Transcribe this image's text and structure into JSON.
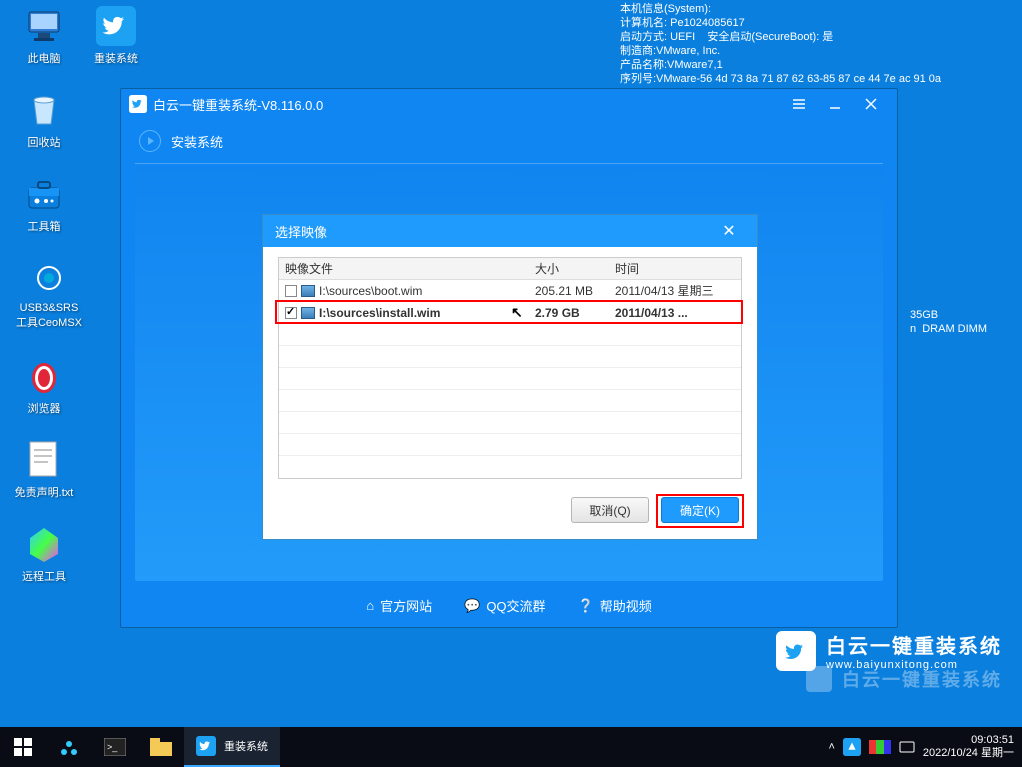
{
  "desktop_icons": {
    "this_pc": "此电脑",
    "reinstall": "重装系统",
    "recycle": "回收站",
    "toolbox": "工具箱",
    "usb3": "USB3&SRS\n工具CeoMSX",
    "browser": "浏览器",
    "disclaimer": "免责声明.txt",
    "remote": "远程工具"
  },
  "system_info": "本机信息(System):\n计算机名: Pe1024085617\n启动方式: UEFI    安全启动(SecureBoot): 是\n制造商:VMware, Inc.\n产品名称:VMware7,1\n序列号:VMware-56 4d 73 8a 71 87 62 63-85 87 ce 44 7e ac 91 0a",
  "system_info_right": "35GB\nn  DRAM DIMM",
  "main_window": {
    "title": "白云一键重装系统-V8.116.0.0",
    "subtitle": "安装系统",
    "footer": {
      "website": "官方网站",
      "qq": "QQ交流群",
      "help": "帮助视频"
    }
  },
  "dialog": {
    "title": "选择映像",
    "headers": {
      "file": "映像文件",
      "size": "大小",
      "time": "时间"
    },
    "rows": [
      {
        "checked": false,
        "file": "I:\\sources\\boot.wim",
        "size": "205.21 MB",
        "time": "2011/04/13 星期三"
      },
      {
        "checked": true,
        "file": "I:\\sources\\install.wim",
        "size": "2.79 GB",
        "time": "2011/04/13 ..."
      }
    ],
    "cancel": "取消(Q)",
    "ok": "确定(K)"
  },
  "brand": {
    "name": "白云一键重装系统",
    "url": "www.baiyunxitong.com"
  },
  "taskbar": {
    "app": "重装系统",
    "time": "09:03:51",
    "date": "2022/10/24 星期一"
  }
}
